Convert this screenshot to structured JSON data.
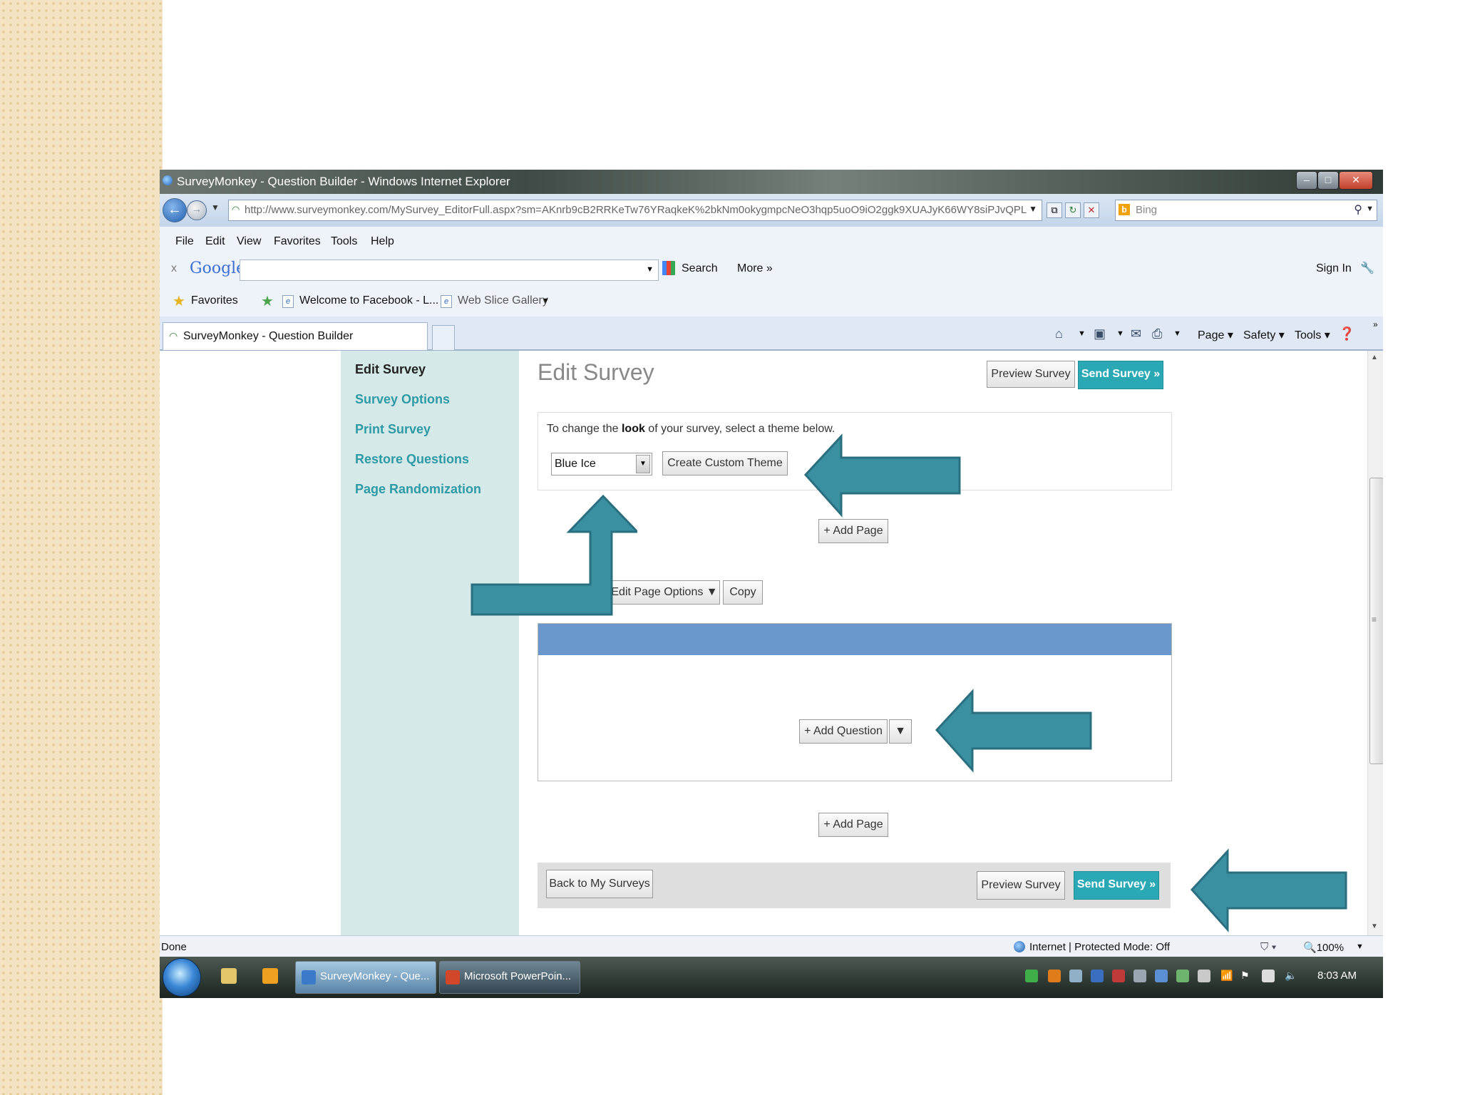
{
  "window": {
    "title": "SurveyMonkey - Question Builder - Windows Internet Explorer"
  },
  "address": {
    "url": "http://www.surveymonkey.com/MySurvey_EditorFull.aspx?sm=AKnrb9cB2RRKeTw76YRaqkeK%2bkNm0okygmpcNeO3hqp5uoO9iO2ggk9XUAJyK66WY8siPJvQPL",
    "search_placeholder": "Bing"
  },
  "menu": [
    "File",
    "Edit",
    "View",
    "Favorites",
    "Tools",
    "Help"
  ],
  "google_bar": {
    "logo": "Google",
    "search": "Search",
    "more": "More »",
    "sign_in": "Sign In"
  },
  "favorites_bar": {
    "favorites": "Favorites",
    "item1": "Welcome to Facebook - L...",
    "item2": "Web Slice Gallery"
  },
  "tab": {
    "title": "SurveyMonkey - Question Builder"
  },
  "command_bar": {
    "page": "Page",
    "safety": "Safety",
    "tools": "Tools"
  },
  "sidebar": {
    "items": [
      "Edit Survey",
      "Survey Options",
      "Print Survey",
      "Restore Questions",
      "Page Randomization"
    ]
  },
  "main": {
    "title": "Edit Survey",
    "preview_button": "Preview Survey",
    "send_button": "Send Survey »",
    "theme_instruction_pre": "To change the ",
    "theme_instruction_bold": "look",
    "theme_instruction_post": " of your survey, select a theme below.",
    "theme_value": "Blue Ice",
    "custom_theme_button": "Create Custom Theme",
    "add_page": "+ Add Page",
    "edit_page_options": "Edit Page Options ▼",
    "copy": "Copy",
    "add_question": "+ Add Question",
    "add_question_menu": "▼",
    "back_button": "Back to My Surveys"
  },
  "status": {
    "text": "Done",
    "zone": "Internet | Protected Mode: Off",
    "zoom": "100%"
  },
  "taskbar": {
    "task1": "SurveyMonkey - Que...",
    "task2": "Microsoft PowerPoin...",
    "clock": "8:03 AM"
  },
  "colors": {
    "teal": "#2aa9b5",
    "arrow": "#3a8fa1",
    "sidebar": "#d4e9e8",
    "page_header": "#6b98cc"
  }
}
